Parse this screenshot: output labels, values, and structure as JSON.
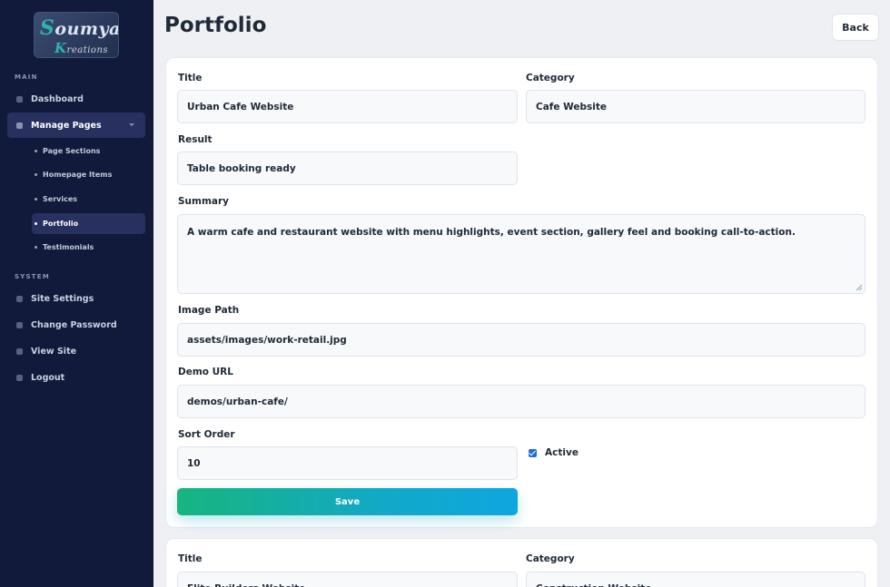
{
  "sidebar": {
    "logo": {
      "main_initial": "S",
      "main_rest": "oumya",
      "sub_initial": "K",
      "sub_rest": "reations"
    },
    "main_label": "MAIN",
    "system_label": "SYSTEM",
    "items": {
      "dashboard": "Dashboard",
      "manage_pages": "Manage Pages",
      "site_settings": "Site Settings",
      "change_password": "Change Password",
      "view_site": "View Site",
      "logout": "Logout"
    },
    "sub_items": {
      "page_sections": "Page Sections",
      "homepage_items": "Homepage Items",
      "services": "Services",
      "portfolio": "Portfolio",
      "testimonials": "Testimonials"
    }
  },
  "header": {
    "title": "Portfolio",
    "back_label": "Back"
  },
  "form1": {
    "title_label": "Title",
    "title_value": "Urban Cafe Website",
    "category_label": "Category",
    "category_value": "Cafe Website",
    "result_label": "Result",
    "result_value": "Table booking ready",
    "summary_label": "Summary",
    "summary_value": "A warm cafe and restaurant website with menu highlights, event section, gallery feel and booking call-to-action.",
    "image_path_label": "Image Path",
    "image_path_value": "assets/images/work-retail.jpg",
    "demo_url_label": "Demo URL",
    "demo_url_value": "demos/urban-cafe/",
    "sort_order_label": "Sort Order",
    "sort_order_value": "10",
    "active_label": "Active",
    "active_checked": true,
    "save_label": "Save"
  },
  "form2": {
    "title_label": "Title",
    "title_value": "Elite Builders Website",
    "category_label": "Category",
    "category_value": "Construction Website"
  },
  "colors": {
    "sidebar_bg": "#111a3a",
    "active_bg": "#27305e",
    "accent_start": "#17b57f",
    "accent_end": "#0fa6e0",
    "checkbox": "#1f6fd6"
  },
  "icons": {
    "chevron": "chevron-down-icon",
    "checkbox": "checkbox-checked-icon"
  }
}
